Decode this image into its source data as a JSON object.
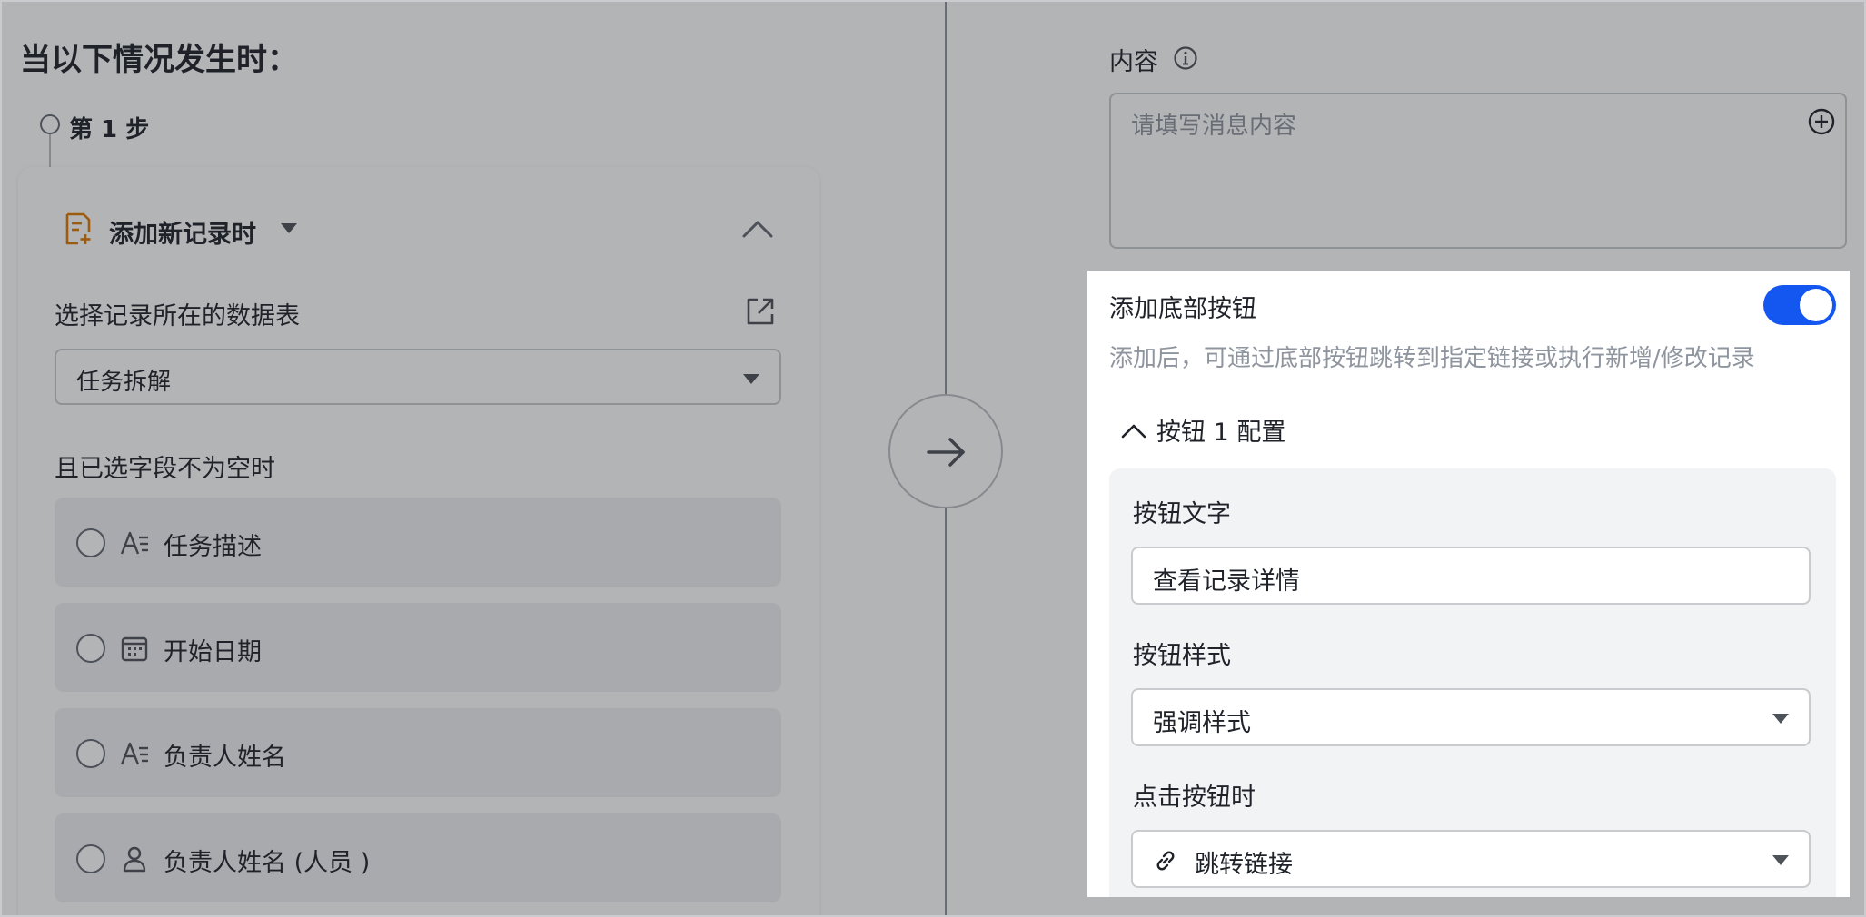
{
  "trigger": {
    "title": "当以下情况发生时：",
    "step_label": "第 1 步",
    "card_title": "添加新记录时",
    "table_label": "选择记录所在的数据表",
    "table_value": "任务拆解",
    "fields_label": "且已选字段不为空时",
    "fields": [
      {
        "name": "任务描述",
        "icon": "text-field-icon"
      },
      {
        "name": "开始日期",
        "icon": "calendar-icon"
      },
      {
        "name": "负责人姓名",
        "icon": "text-field-icon"
      },
      {
        "name": "负责人姓名 (人员 )",
        "icon": "person-icon"
      }
    ]
  },
  "action": {
    "content_label": "内容",
    "content_placeholder": "请填写消息内容",
    "bottom_button": {
      "title": "添加底部按钮",
      "enabled": true,
      "description": "添加后，可通过底部按钮跳转到指定链接或执行新增/修改记录",
      "config_title": "按钮 1 配置",
      "text_label": "按钮文字",
      "text_value": "查看记录详情",
      "style_label": "按钮样式",
      "style_value": "强调样式",
      "click_label": "点击按钮时",
      "click_value": "跳转链接"
    }
  },
  "colors": {
    "accent": "#1456f0",
    "trigger_icon": "#de7802",
    "overlay": "rgba(31,35,41,0.34)"
  }
}
